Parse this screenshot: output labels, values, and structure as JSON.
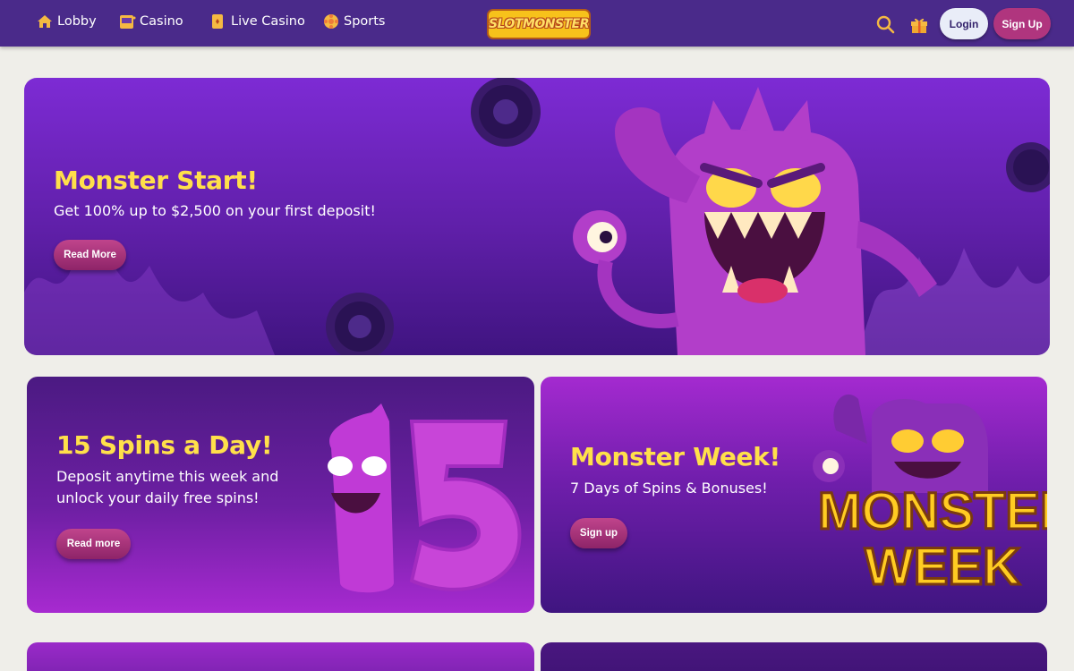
{
  "nav": {
    "items": [
      {
        "label": "Lobby",
        "icon": "home-icon"
      },
      {
        "label": "Casino",
        "icon": "slot-machine-icon"
      },
      {
        "label": "Live Casino",
        "icon": "cards-icon"
      },
      {
        "label": "Sports",
        "icon": "ball-icon"
      }
    ],
    "logo": "SLOTMONSTER",
    "login_label": "Login",
    "signup_label": "Sign Up"
  },
  "hero": {
    "title": "Monster Start!",
    "text": "Get 100% up to $2,500 on your first deposit!",
    "button": "Read More"
  },
  "promos": [
    {
      "title": "15 Spins a Day!",
      "text_line1": "Deposit anytime this week and",
      "text_line2": "unlock your daily free spins!",
      "button": "Read more",
      "art_text": "15"
    },
    {
      "title": "Monster Week!",
      "text": "7 Days of Spins & Bonuses!",
      "button": "Sign up",
      "art_line1": "MONSTER",
      "art_line2": "WEEK"
    }
  ],
  "colors": {
    "nav_bg": "#4a2a8a",
    "title_yellow": "#ffe04a",
    "button_pink": "#b0357e",
    "page_bg": "#efeee9"
  }
}
